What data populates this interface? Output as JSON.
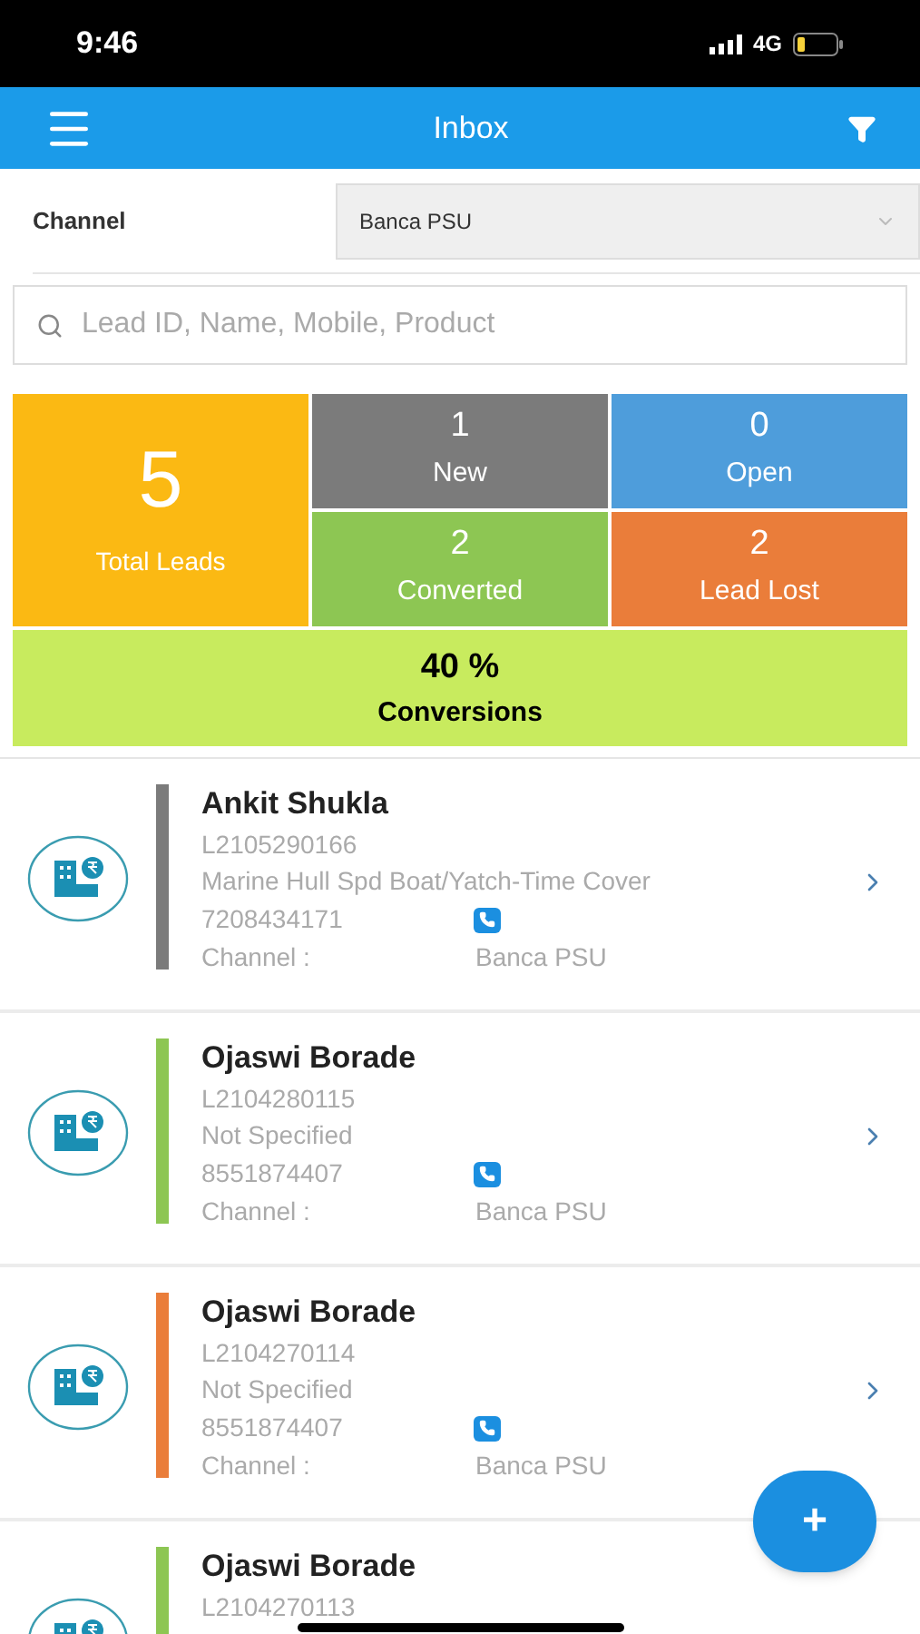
{
  "status_bar": {
    "time": "9:46",
    "network": "4G"
  },
  "header": {
    "title": "Inbox"
  },
  "channel": {
    "label": "Channel",
    "value": "Banca PSU"
  },
  "search": {
    "placeholder": "Lead ID, Name, Mobile, Product"
  },
  "stats": {
    "total": {
      "value": "5",
      "label": "Total Leads"
    },
    "tiles": [
      {
        "value": "1",
        "label": "New",
        "color": "#7b7b7b"
      },
      {
        "value": "0",
        "label": "Open",
        "color": "#4e9ddb"
      },
      {
        "value": "2",
        "label": "Converted",
        "color": "#8dc653"
      },
      {
        "value": "2",
        "label": "Lead Lost",
        "color": "#ea7d3a"
      }
    ],
    "conversion": {
      "value": "40 %",
      "label": "Conversions"
    }
  },
  "leads": [
    {
      "name": "Ankit Shukla",
      "lead_id": "L2105290166",
      "product": "Marine Hull Spd Boat/Yatch-Time Cover",
      "mobile": "7208434171",
      "channel_label": "Channel :",
      "channel": "Banca PSU",
      "color": "#7b7b7b"
    },
    {
      "name": "Ojaswi Borade",
      "lead_id": "L2104280115",
      "product": "Not Specified",
      "mobile": "8551874407",
      "channel_label": "Channel :",
      "channel": "Banca PSU",
      "color": "#8dc653"
    },
    {
      "name": "Ojaswi Borade",
      "lead_id": "L2104270114",
      "product": "Not Specified",
      "mobile": "8551874407",
      "channel_label": "Channel :",
      "channel": "Banca PSU",
      "color": "#ea7d3a"
    },
    {
      "name": "Ojaswi Borade",
      "lead_id": "L2104270113",
      "color": "#8dc653"
    }
  ],
  "fab": {
    "label": "+"
  }
}
